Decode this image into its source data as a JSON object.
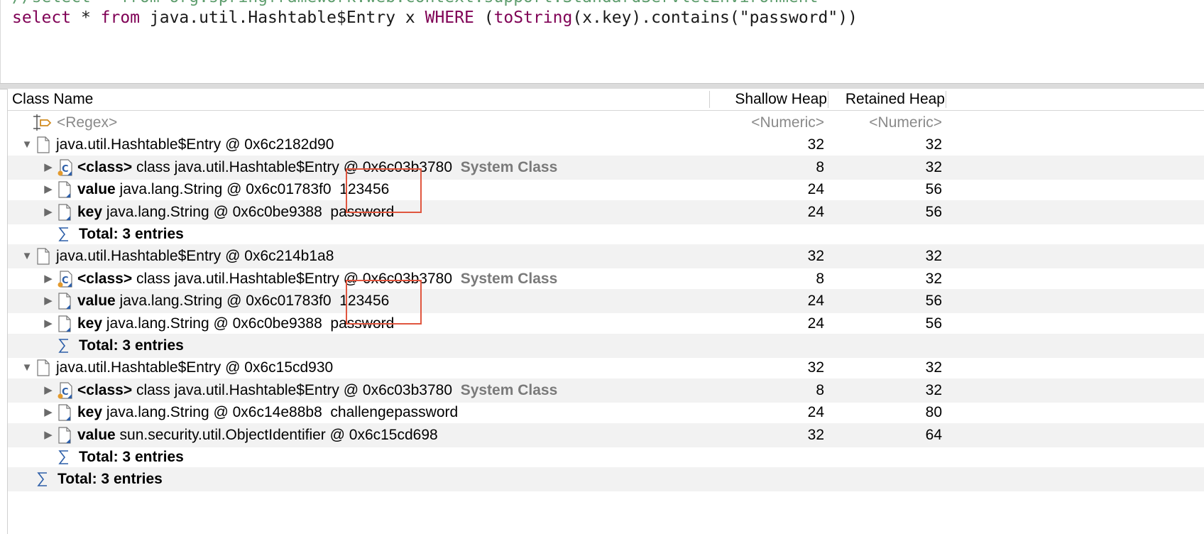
{
  "query": {
    "line1": "//select * from org.springframework.web.context.support.StandardServletEnvironment",
    "line2_parts": [
      "select",
      " * ",
      "from",
      " java.util.Hashtable$Entry x ",
      "WHERE",
      " (",
      "toString",
      "(x.key).contains(\"password\"))"
    ]
  },
  "table": {
    "columns": {
      "name": "Class Name",
      "shallow": "Shallow Heap",
      "retained": "Retained Heap"
    },
    "filter": {
      "name": "<Regex>",
      "shallow": "<Numeric>",
      "retained": "<Numeric>"
    },
    "rows": [
      {
        "depth": 0,
        "kind": "entry",
        "expander": "▼",
        "label": "java.util.Hashtable$Entry @ 0x6c2182d90",
        "shallow": "32",
        "retained": "32"
      },
      {
        "depth": 1,
        "kind": "class",
        "expander": "▶",
        "field": "<class>",
        "label": "class java.util.Hashtable$Entry @ 0x6c03b3780",
        "extra": "System Class",
        "shallow": "8",
        "retained": "32"
      },
      {
        "depth": 1,
        "kind": "obj",
        "expander": "▶",
        "field": "value",
        "label": "java.lang.String @ 0x6c01783f0",
        "extra": "123456",
        "shallow": "24",
        "retained": "56"
      },
      {
        "depth": 1,
        "kind": "obj",
        "expander": "▶",
        "field": "key",
        "label": "java.lang.String @ 0x6c0be9388",
        "extra": "password",
        "shallow": "24",
        "retained": "56"
      },
      {
        "depth": 1,
        "kind": "total",
        "label": "Total: 3 entries"
      },
      {
        "depth": 0,
        "kind": "entry",
        "expander": "▼",
        "label": "java.util.Hashtable$Entry @ 0x6c214b1a8",
        "shallow": "32",
        "retained": "32"
      },
      {
        "depth": 1,
        "kind": "class",
        "expander": "▶",
        "field": "<class>",
        "label": "class java.util.Hashtable$Entry @ 0x6c03b3780",
        "extra": "System Class",
        "shallow": "8",
        "retained": "32"
      },
      {
        "depth": 1,
        "kind": "obj",
        "expander": "▶",
        "field": "value",
        "label": "java.lang.String @ 0x6c01783f0",
        "extra": "123456",
        "shallow": "24",
        "retained": "56"
      },
      {
        "depth": 1,
        "kind": "obj",
        "expander": "▶",
        "field": "key",
        "label": "java.lang.String @ 0x6c0be9388",
        "extra": "password",
        "shallow": "24",
        "retained": "56"
      },
      {
        "depth": 1,
        "kind": "total",
        "label": "Total: 3 entries"
      },
      {
        "depth": 0,
        "kind": "entry",
        "expander": "▼",
        "label": "java.util.Hashtable$Entry @ 0x6c15cd930",
        "shallow": "32",
        "retained": "32"
      },
      {
        "depth": 1,
        "kind": "class",
        "expander": "▶",
        "field": "<class>",
        "label": "class java.util.Hashtable$Entry @ 0x6c03b3780",
        "extra": "System Class",
        "shallow": "8",
        "retained": "32"
      },
      {
        "depth": 1,
        "kind": "obj",
        "expander": "▶",
        "field": "key",
        "label": "java.lang.String @ 0x6c14e88b8",
        "extra": "challengepassword",
        "shallow": "24",
        "retained": "80"
      },
      {
        "depth": 1,
        "kind": "obj",
        "expander": "▶",
        "field": "value",
        "label": "sun.security.util.ObjectIdentifier @ 0x6c15cd698",
        "shallow": "32",
        "retained": "64"
      },
      {
        "depth": 1,
        "kind": "total",
        "label": "Total: 3 entries"
      },
      {
        "depth": 0,
        "kind": "total",
        "label": "Total: 3 entries"
      }
    ]
  },
  "colors": {
    "highlight": "#e0563f",
    "keyword": "#7f0055",
    "comment": "#5f9e6e"
  }
}
